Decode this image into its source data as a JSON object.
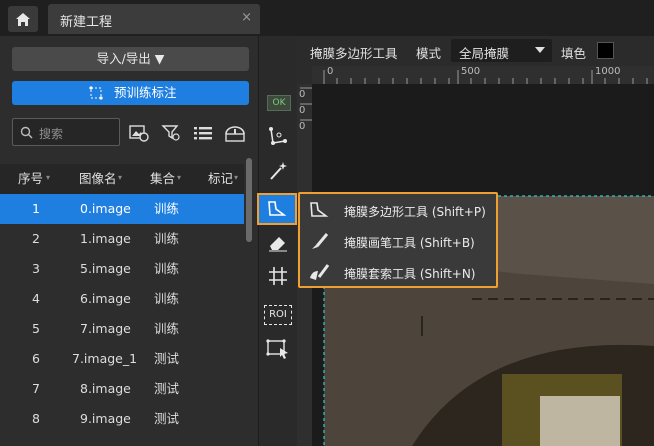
{
  "tabbar": {
    "tab_title": "新建工程",
    "close_glyph": "×"
  },
  "left": {
    "import_label": "导入/导出 ▼",
    "pretrain_label": "预训练标注",
    "search_placeholder": "搜索",
    "columns": [
      "序号",
      "图像名",
      "集合",
      "标记"
    ],
    "rows": [
      {
        "index": "1",
        "name": "0.image",
        "set": "训练"
      },
      {
        "index": "2",
        "name": "1.image",
        "set": "训练"
      },
      {
        "index": "3",
        "name": "5.image",
        "set": "训练"
      },
      {
        "index": "4",
        "name": "6.image",
        "set": "训练"
      },
      {
        "index": "5",
        "name": "7.image",
        "set": "训练"
      },
      {
        "index": "6",
        "name": "7.image_1",
        "set": "测试"
      },
      {
        "index": "7",
        "name": "8.image",
        "set": "测试"
      },
      {
        "index": "8",
        "name": "9.image",
        "set": "测试"
      }
    ],
    "accent": "#1f7fe0"
  },
  "vtoolbar": {
    "ok_label": "OK",
    "roi_label": "ROI"
  },
  "topbar": {
    "tool_name": "掩膜多边形工具",
    "mode_label": "模式",
    "mode_value": "全局掩膜",
    "fill_label": "填色"
  },
  "ruler": {
    "h_ticks": [
      "0",
      "500",
      "1000"
    ],
    "v_ticks": [
      "0",
      "0",
      "0"
    ]
  },
  "popup": {
    "items": [
      {
        "label": "掩膜多边形工具 (Shift+P)",
        "icon": "mask-polygon-icon"
      },
      {
        "label": "掩膜画笔工具 (Shift+B)",
        "icon": "mask-brush-icon"
      },
      {
        "label": "掩膜套索工具 (Shift+N)",
        "icon": "mask-lasso-icon"
      }
    ],
    "highlight": "#f0a030"
  }
}
